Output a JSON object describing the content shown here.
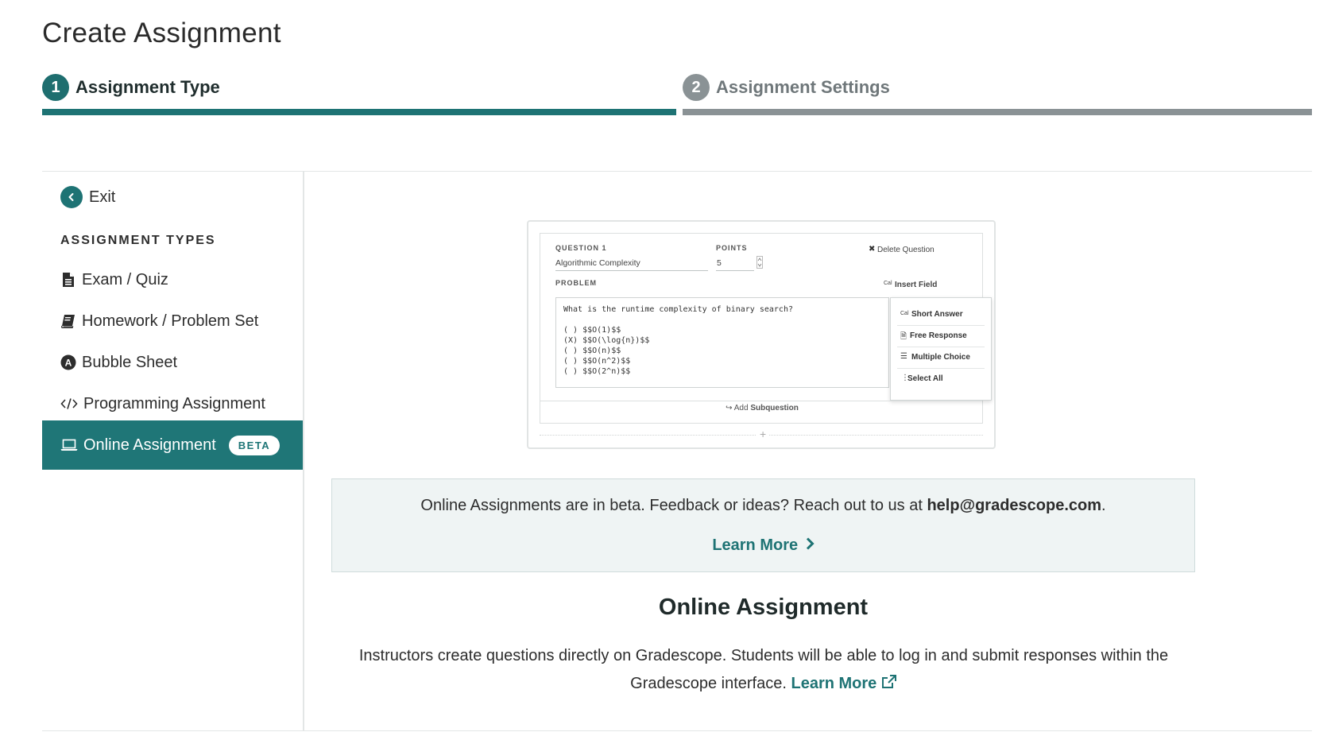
{
  "page_title": "Create Assignment",
  "stepper": {
    "steps": [
      {
        "number": "1",
        "label": "Assignment Type",
        "state": "active"
      },
      {
        "number": "2",
        "label": "Assignment Settings",
        "state": "inactive"
      }
    ]
  },
  "sidebar": {
    "exit_label": "Exit",
    "heading": "ASSIGNMENT TYPES",
    "items": [
      {
        "label": "Exam / Quiz",
        "icon": "file-text-icon"
      },
      {
        "label": "Homework / Problem Set",
        "icon": "book-icon"
      },
      {
        "label": "Bubble Sheet",
        "icon": "bubble-a-icon"
      },
      {
        "label": "Programming Assignment",
        "icon": "code-icon"
      },
      {
        "label": "Online Assignment",
        "icon": "laptop-icon",
        "badge": "BETA",
        "selected": true
      }
    ]
  },
  "preview": {
    "question_label": "QUESTION 1",
    "question_value": "Algorithmic Complexity",
    "points_label": "POINTS",
    "points_value": "5",
    "delete_label": "Delete Question",
    "problem_label": "PROBLEM",
    "insert_field_label": "Insert Field",
    "problem_code": "What is the runtime complexity of binary search?\n\n( ) $$O(1)$$\n(X) $$O(\\log{n})$$\n( ) $$O(n)$$\n( ) $$O(n^2)$$\n( ) $$O(2^n)$$",
    "dropdown": [
      "Short Answer",
      "Free Response",
      "Multiple Choice",
      "Select All"
    ],
    "add_subquestion_prefix": "Add",
    "add_subquestion_label": "Subquestion",
    "plus": "+"
  },
  "banner": {
    "text": "Online Assignments are in beta. Feedback or ideas? Reach out to us at ",
    "email": "help@gradescope.com",
    "suffix": ".",
    "link_label": "Learn More"
  },
  "detail": {
    "title": "Online Assignment",
    "description": "Instructors create questions directly on Gradescope. Students will be able to log in and submit responses within the Gradescope interface. ",
    "link_label": "Learn More"
  },
  "colors": {
    "accent": "#1e7374",
    "inactive": "#8a9295",
    "banner_bg": "#eff4f4"
  }
}
